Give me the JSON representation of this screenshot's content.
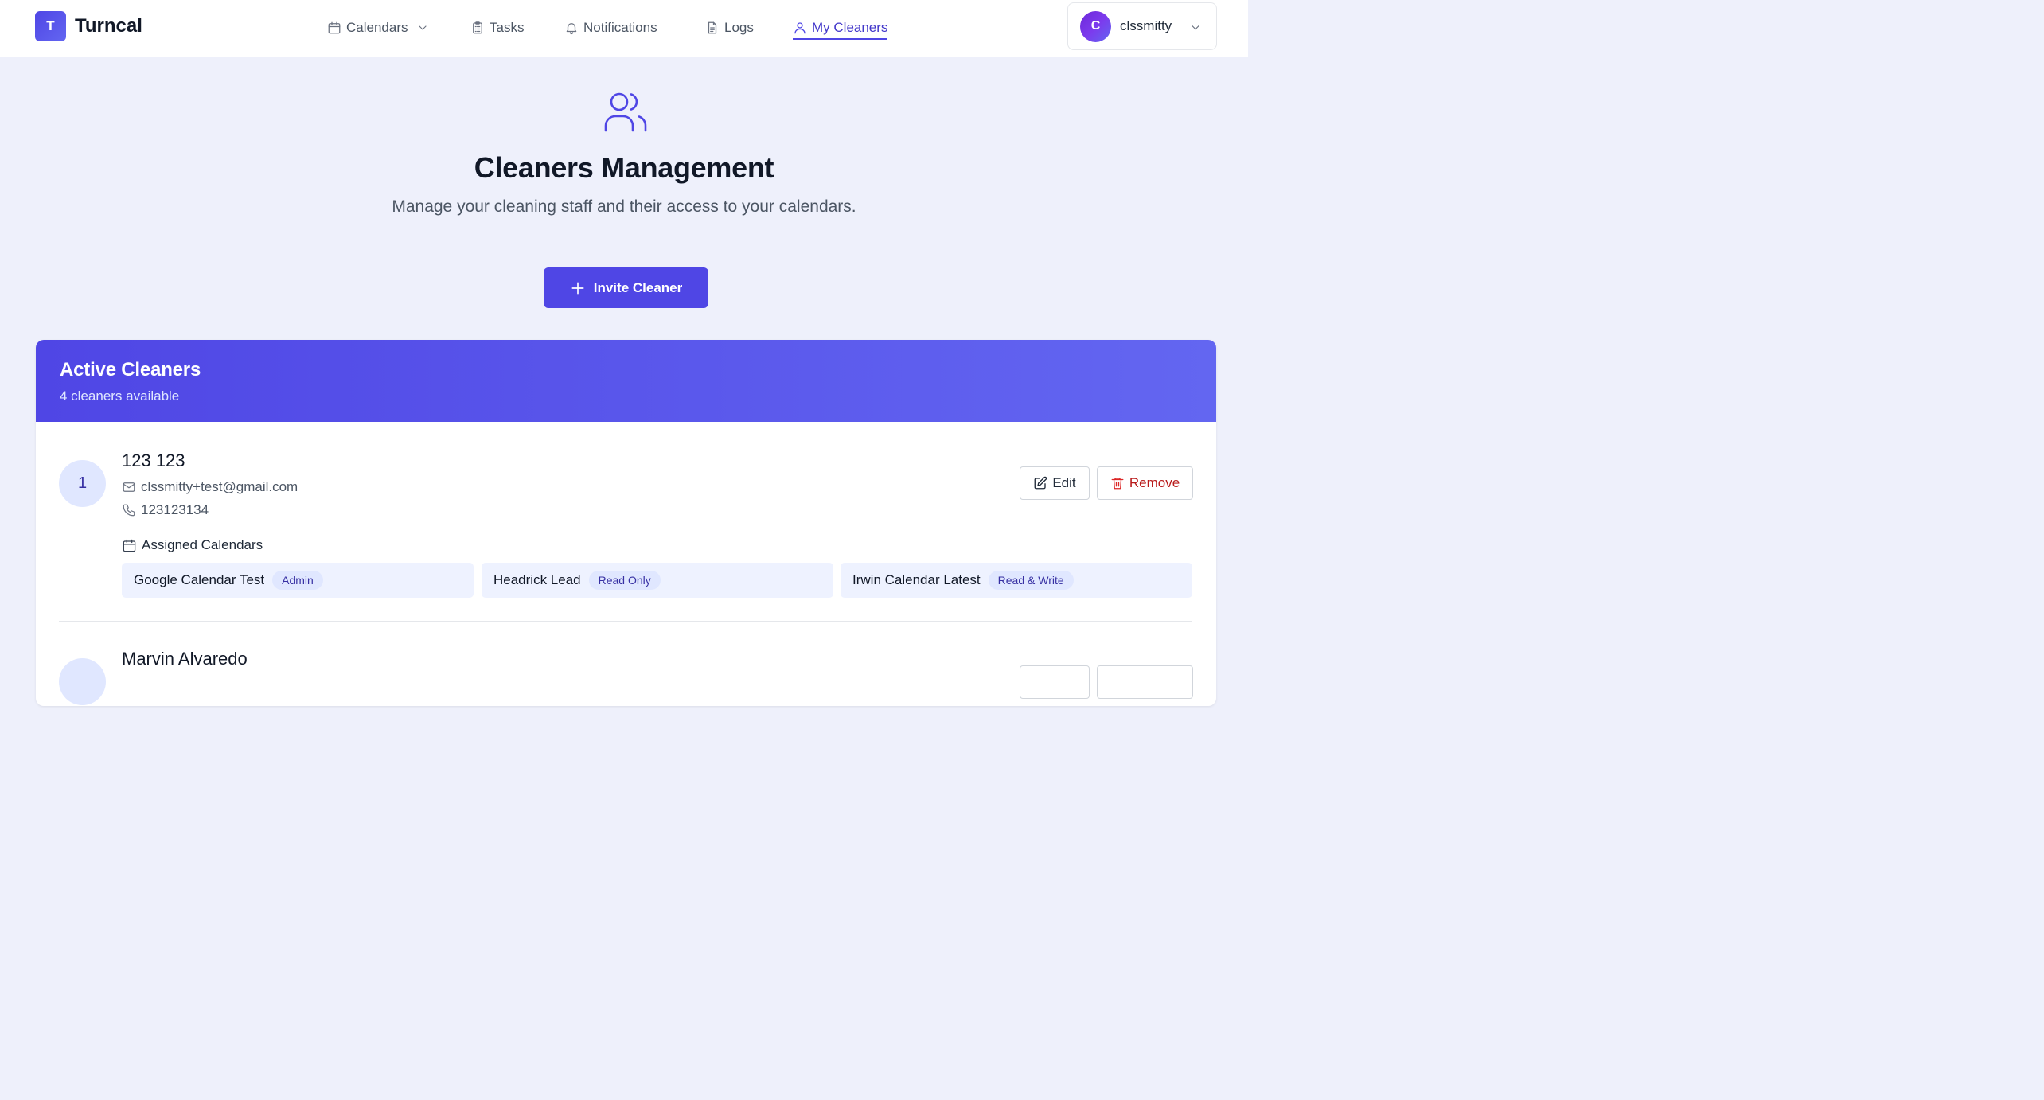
{
  "app": {
    "logo_letter": "T",
    "name": "Turncal"
  },
  "nav": {
    "calendars": "Calendars",
    "tasks": "Tasks",
    "notifications": "Notifications",
    "logs": "Logs",
    "my_cleaners": "My Cleaners",
    "active": "my_cleaners"
  },
  "user": {
    "initial": "C",
    "name": "clssmitty"
  },
  "hero": {
    "title": "Cleaners Management",
    "subtitle": "Manage your cleaning staff and their access to your calendars.",
    "invite_label": "Invite Cleaner"
  },
  "card": {
    "title": "Active Cleaners",
    "count_text": "4 cleaners available"
  },
  "cleaners": [
    {
      "number": "1",
      "name": "123 123",
      "email": "clssmitty+test@gmail.com",
      "phone": "123123134",
      "assigned_label": "Assigned Calendars",
      "calendars": [
        {
          "name": "Google Calendar Test",
          "permission": "Admin"
        },
        {
          "name": "Headrick Lead",
          "permission": "Read Only"
        },
        {
          "name": "Irwin Calendar Latest",
          "permission": "Read & Write"
        }
      ],
      "edit_label": "Edit",
      "remove_label": "Remove"
    },
    {
      "number": "",
      "name": "Marvin Alvaredo"
    }
  ],
  "colors": {
    "primary": "#4f46e5",
    "background": "#eef0fb",
    "danger": "#b91c1c"
  }
}
